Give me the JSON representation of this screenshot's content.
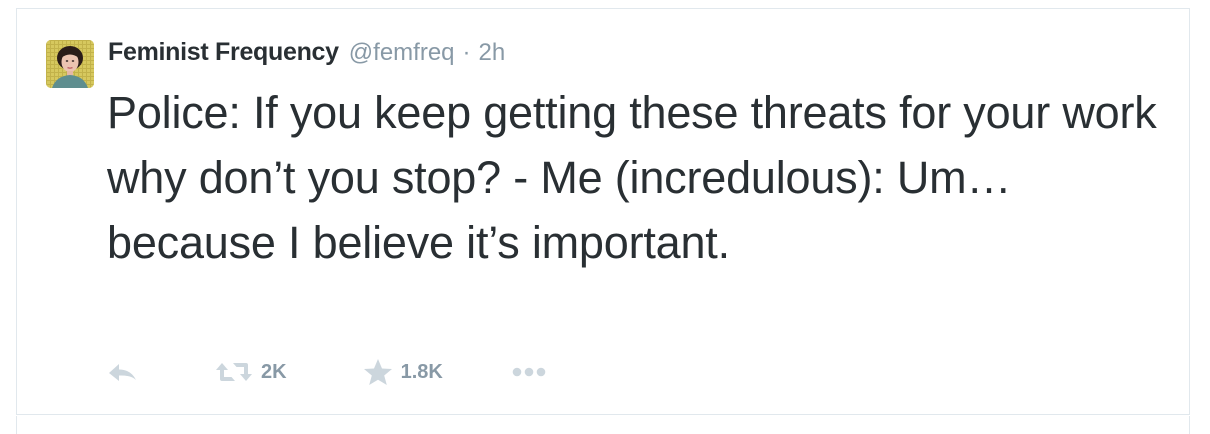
{
  "tweet": {
    "author": {
      "full_name": "Feminist Frequency",
      "username": "@femfreq",
      "avatar_icon": "profile-photo"
    },
    "separator": "·",
    "timestamp": "2h",
    "text": "Police: If you keep getting these threats for your work why don’t you stop? - Me (incredulous): Um… because I believe it’s important.",
    "actions": {
      "reply_icon": "reply-icon",
      "retweet_icon": "retweet-icon",
      "retweet_count": "2K",
      "favorite_icon": "star-icon",
      "favorite_count": "1.8K",
      "more_icon": "more-icon"
    }
  },
  "colors": {
    "text": "#292f33",
    "muted": "#8899a6",
    "icon": "#ccd6dd",
    "border": "#e1e8ed"
  }
}
